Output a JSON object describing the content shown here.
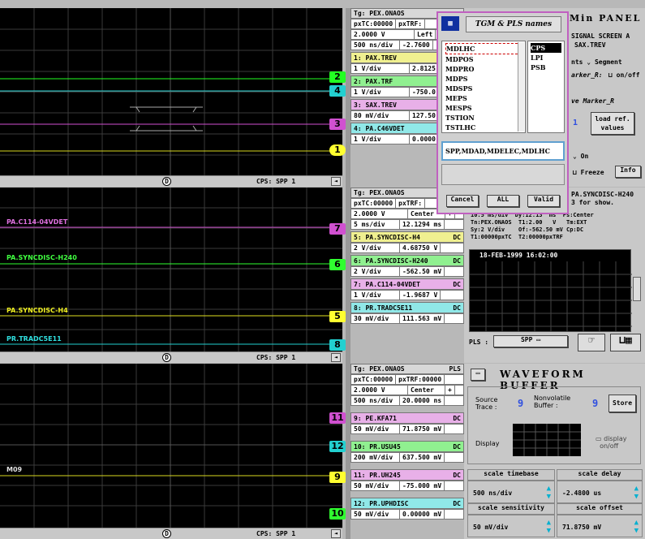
{
  "scope1": {
    "bottom_status": "CPS: SPP 1",
    "labels": []
  },
  "scope2": {
    "bottom_status": "CPS: SPP 1",
    "labels": [
      "PA.C114-04VDET",
      "PA.SYNCDISC-H240",
      "PA.SYNCDISC-H4",
      "PR.TRADC5E11"
    ]
  },
  "scope3": {
    "bottom_status": "CPS: SPP 1",
    "labels": [
      "M09"
    ]
  },
  "d_marker": "D",
  "strip1": [
    "2",
    "4",
    "3",
    "1"
  ],
  "strip2": [
    "7",
    "6",
    "5",
    "8"
  ],
  "strip3": [
    "11",
    "12",
    "9",
    "10"
  ],
  "panelA": {
    "tag": "A",
    "tg": "Tg: PEX.ONAOS",
    "ptc": "pxTC:00000",
    "ptrf": "pxTRF:",
    "volt": "2.0000 V",
    "mode": "Left",
    "tb": "500 ns/div",
    "off": "-2.7600",
    "channels": [
      {
        "name": "1: PAX.TREV",
        "scale": "1 V/div",
        "val": "2.8125"
      },
      {
        "name": "2: PAX.TRF",
        "scale": "1 V/div",
        "val": "-750.0"
      },
      {
        "name": "3: SAX.TREV",
        "scale": "80 mV/div",
        "val": "127.50"
      },
      {
        "name": "4: PA.C46VDET",
        "scale": "1 V/div",
        "val": "0.0000"
      }
    ]
  },
  "panelB": {
    "tag": "B",
    "tg": "Tg: PEX.ONAOS",
    "ptc": "pxTC:00000",
    "ptrf": "pxTRF:",
    "volt": "2.0000 V",
    "mode": "Center",
    "plus": "+",
    "tb": "5 ms/div",
    "off": "12.1294 ms",
    "channels": [
      {
        "name": "5: PA.SYNCDISC-H4",
        "cp": "DC",
        "scale": "2 V/div",
        "val": "4.68750 V"
      },
      {
        "name": "6: PA.SYNCDISC-H240",
        "cp": "DC",
        "scale": "2 V/div",
        "val": "-562.50 mV"
      },
      {
        "name": "7: PA.C114-04VDET",
        "cp": "DC",
        "scale": "1 V/div",
        "val": "-1.9687 V"
      },
      {
        "name": "8: PR.TRADC5E11",
        "cp": "DC",
        "scale": "30 mV/div",
        "val": "111.563 mV"
      }
    ]
  },
  "panelC": {
    "tag": "C",
    "tg": "Tg: PEX.ONAOS",
    "pls": "PLS",
    "ptc": "pxTC:00000",
    "ptrf": "pxTRF:00000",
    "volt": "2.0000 V",
    "mode": "Center",
    "plus": "+",
    "tb": "500 ns/div",
    "off": "20.0000 ns",
    "channels": [
      {
        "name": "9: PE.KFA71",
        "cp": "DC",
        "scale": "50 mV/div",
        "val": "71.8750 mV"
      },
      {
        "name": "10: PR.USU45",
        "cp": "DC",
        "scale": "200 mV/div",
        "val": "637.500 mV"
      },
      {
        "name": "11: PR.UH245",
        "cp": "DC",
        "scale": "50 mV/div",
        "val": "-75.000 mV"
      },
      {
        "name": "12: PR.UPHDISC",
        "cp": "DC",
        "scale": "50 mV/div",
        "val": "0.00000 mV"
      }
    ]
  },
  "dialog": {
    "title": "TGM & PLS names",
    "list": [
      "MDLHC",
      "MDPOS",
      "MDPRO",
      "MDPS",
      "MDSPS",
      "MEPS",
      "MESPS",
      "TSTION",
      "TSTLHC"
    ],
    "list2": [
      "CPS",
      "LPI",
      "PSB"
    ],
    "field": "SPP,MDAD,MDELEC,MDLHC",
    "cancel": "Cancel",
    "all": "ALL",
    "valid": "Valid"
  },
  "right_top": {
    "title": "Min PANEL",
    "sub1": "SIGNAL SCREEN A",
    "sub2": "SAX.TREV",
    "seg1": "nts",
    "seg2": "Segment",
    "marker": "arker_R:",
    "onoff": "on/off",
    "move": "ve Marker_R",
    "one": "1",
    "load1": "load ref.",
    "load2": "values",
    "on": "On",
    "freeze": "Freeze",
    "info": "Info"
  },
  "right_mid": {
    "line1": "PA.SYNCDISC-H240",
    "line2": "3 for show.",
    "tl1": "10.5 ms/div  Dy:12.13  ms  Ps:Center",
    "tl2": "Tn:PEX.ONAOS  T1:2.00   V   Tm:EXT",
    "tl3": "Sy:2 V/div    Of:-562.50 mV Cp:DC",
    "tl4": "T1:00000pxTC  T2:00000pxTRF",
    "date": "18-FEB-1999 16:02:00",
    "pls": "PLS :",
    "pls_val": "SPP"
  },
  "wave": {
    "title": "WAVEFORM BUFFER",
    "src1": "Source",
    "src2": "Trace :",
    "src_val": "9",
    "nv1": "Nonvolatile",
    "nv2": "Buffer :",
    "nv_val": "9",
    "store": "Store",
    "display": "Display",
    "disp1": "display",
    "disp2": "on/off",
    "cells": [
      {
        "h": "scale timebase",
        "v": "500 ns/div"
      },
      {
        "h": "scale delay",
        "v": "-2.4800  us"
      },
      {
        "h": "scale sensitivity",
        "v": "50 mV/div"
      },
      {
        "h": "scale offset",
        "v": "71.8750  mV"
      }
    ]
  }
}
